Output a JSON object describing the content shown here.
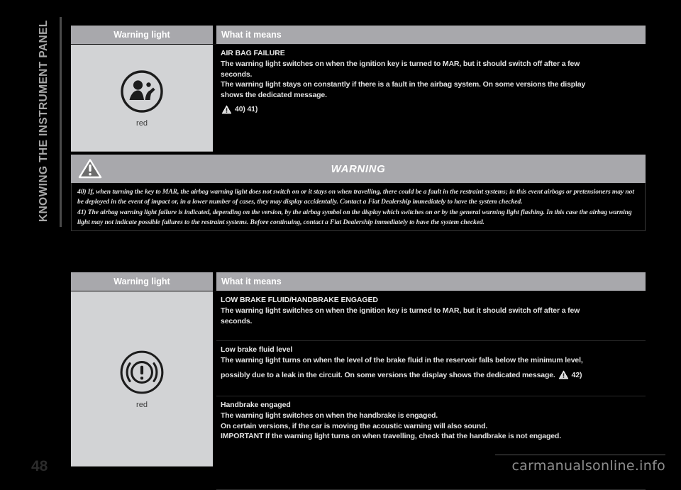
{
  "chapter": {
    "title": "KNOWING THE INSTRUMENT PANEL"
  },
  "footer": {
    "page_number": "48",
    "watermark": "carmanualsonline.info"
  },
  "table_headers": {
    "warning_light": "Warning light",
    "what_it_means": "What it means"
  },
  "tables": [
    {
      "light_color_caption": "red",
      "light_icon": "airbag-failure-icon",
      "sections": [
        {
          "title": "AIR BAG FAILURE",
          "lines": [
            "The warning light switches on when the ignition key is turned to MAR, but it should switch off after a few",
            "seconds.",
            "The warning light stays on constantly if there is a fault in the airbag system. On some versions the display",
            "shows the dedicated message."
          ],
          "reference": "40) 41)",
          "reference_icon": "warning-triangle-icon"
        }
      ]
    },
    {
      "light_color_caption": "red",
      "light_icon": "brake-warning-icon",
      "sections": [
        {
          "title": "LOW BRAKE FLUID/HANDBRAKE ENGAGED",
          "lines": [
            "The warning light switches on when the ignition key is turned to MAR, but it should switch off after a few",
            "seconds."
          ],
          "reference": "",
          "reference_icon": ""
        },
        {
          "title": "Low brake fluid level",
          "lines": [
            "The warning light turns on when the level of the brake fluid in the reservoir falls below the minimum level,",
            "possibly due to a leak in the circuit. On some versions the display shows the dedicated message."
          ],
          "reference": "42)",
          "reference_icon": "warning-triangle-icon"
        },
        {
          "title": "Handbrake engaged",
          "lines": [
            "The warning light switches on when the handbrake is engaged.",
            "On certain versions, if the car is moving the acoustic warning will also sound.",
            "IMPORTANT If the warning light turns on when travelling, check that the handbrake is not engaged."
          ],
          "reference": "",
          "reference_icon": ""
        }
      ]
    }
  ],
  "warning_box": {
    "banner_title": "WARNING",
    "banner_icon": "warning-triangle-icon",
    "paragraphs": [
      "40) If, when turning the key to MAR, the airbag warning light does not switch on or it stays on when travelling, there could be a fault in the restraint systems; in this event airbags or pretensioners may not be deployed in the event of impact or, in a lower number of cases, they may display accidentally. Contact a Fiat Dealership immediately to have the system checked.",
      "41) The airbag warning light failure is indicated, depending on the version, by the airbag symbol on the display which switches on or by the general warning light flashing. In this case the airbag warning light may not indicate possible failures to the restraint systems. Before continuing, contact a Fiat Dealership immediately to have the system checked."
    ]
  },
  "colors": {
    "page_background": "#000000",
    "header_gray": "#a8a8ac",
    "cell_gray": "#d2d3d5",
    "text_light": "#e2e2e2",
    "chapter_tab": "#a8a8a8"
  }
}
